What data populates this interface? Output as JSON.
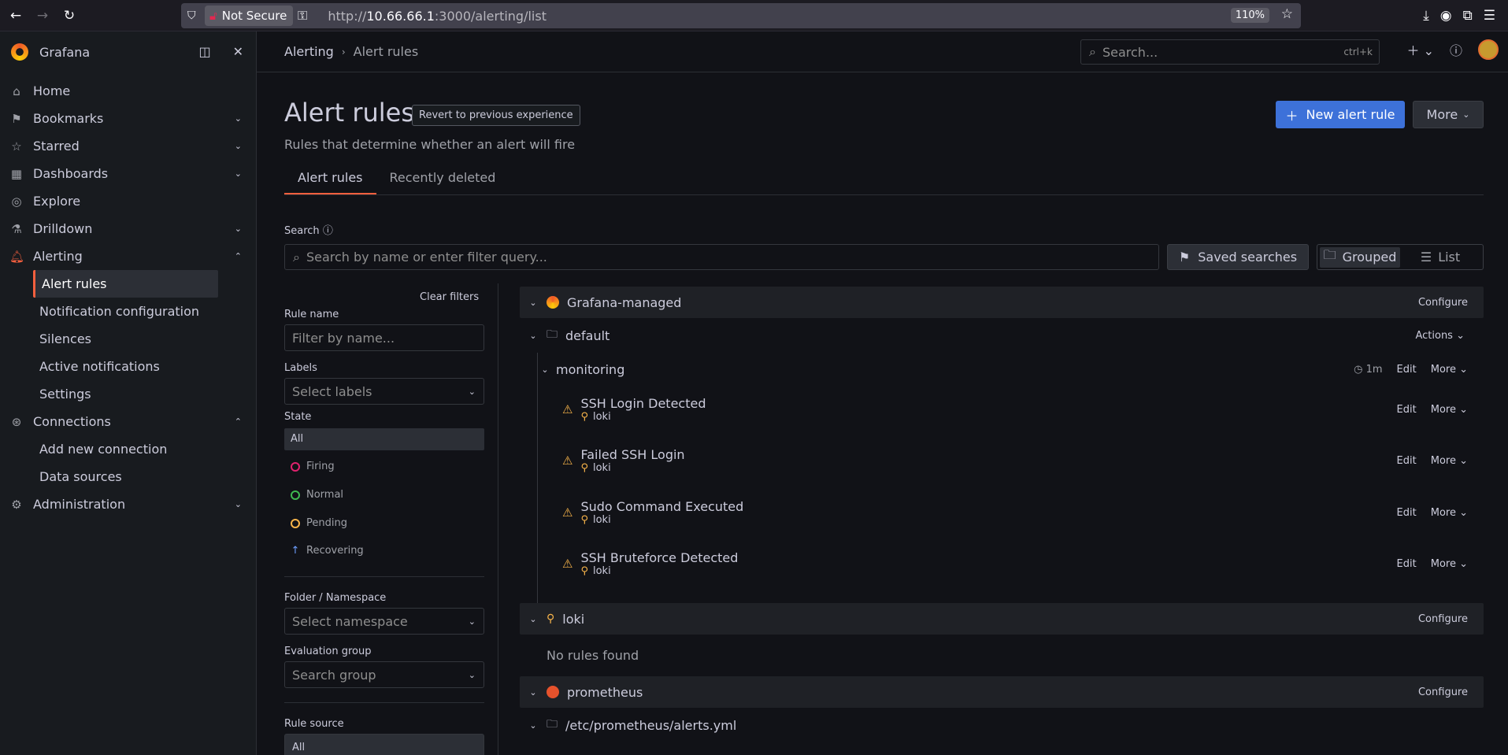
{
  "browser": {
    "security_label": "Not Secure",
    "url_prefix": "http://",
    "url_host": "10.66.66.1",
    "url_path": ":3000/alerting/list",
    "zoom": "110%"
  },
  "sidebar": {
    "brand": "Grafana",
    "items": [
      {
        "label": "Home",
        "icon": "home-icon"
      },
      {
        "label": "Bookmarks",
        "icon": "bookmark-icon"
      },
      {
        "label": "Starred",
        "icon": "star-icon"
      },
      {
        "label": "Dashboards",
        "icon": "apps-icon"
      },
      {
        "label": "Explore",
        "icon": "compass-icon"
      },
      {
        "label": "Drilldown",
        "icon": "drilldown-icon"
      },
      {
        "label": "Alerting",
        "icon": "bell-icon"
      },
      {
        "label": "Connections",
        "icon": "connections-icon"
      },
      {
        "label": "Administration",
        "icon": "cog-icon"
      }
    ],
    "alerting_sub": [
      "Alert rules",
      "Notification configuration",
      "Silences",
      "Active notifications",
      "Settings"
    ],
    "connections_sub": [
      "Add new connection",
      "Data sources"
    ]
  },
  "topbar": {
    "breadcrumb": [
      "Alerting",
      "Alert rules"
    ],
    "search_placeholder": "Search...",
    "search_shortcut": "ctrl+k"
  },
  "page": {
    "title": "Alert rules",
    "revert_label": "Revert to previous experience",
    "subtitle": "Rules that determine whether an alert will fire",
    "new_rule_label": "New alert rule",
    "more_label": "More",
    "tabs": [
      "Alert rules",
      "Recently deleted"
    ],
    "search_label": "Search",
    "search_placeholder": "Search by name or enter filter query...",
    "saved_searches_label": "Saved searches",
    "view_grouped": "Grouped",
    "view_list": "List"
  },
  "filters": {
    "clear_label": "Clear filters",
    "rule_name_label": "Rule name",
    "rule_name_placeholder": "Filter by name...",
    "labels_label": "Labels",
    "labels_placeholder": "Select labels",
    "state_label": "State",
    "states": [
      "All",
      "Firing",
      "Normal",
      "Pending",
      "Recovering"
    ],
    "folder_label": "Folder / Namespace",
    "folder_placeholder": "Select namespace",
    "group_label": "Evaluation group",
    "group_placeholder": "Search group",
    "source_label": "Rule source",
    "source_value": "All"
  },
  "rules": {
    "grafana_managed": "Grafana-managed",
    "configure_label": "Configure",
    "folder": "default",
    "actions_label": "Actions",
    "group": "monitoring",
    "group_interval": "1m",
    "edit_label": "Edit",
    "more_label": "More",
    "items": [
      {
        "title": "SSH Login Detected",
        "source": "loki"
      },
      {
        "title": "Failed SSH Login",
        "source": "loki"
      },
      {
        "title": "Sudo Command Executed",
        "source": "loki"
      },
      {
        "title": "SSH Bruteforce Detected",
        "source": "loki"
      }
    ],
    "loki_name": "loki",
    "no_rules": "No rules found",
    "prometheus_name": "prometheus",
    "prometheus_folder": "/etc/prometheus/alerts.yml"
  },
  "colors": {
    "accent": "#f55f3e",
    "primary": "#3d71d9",
    "warning": "#f8b44a",
    "firing": "#e0226e",
    "normal": "#1a7f4b",
    "pending": "#f8b44a"
  }
}
